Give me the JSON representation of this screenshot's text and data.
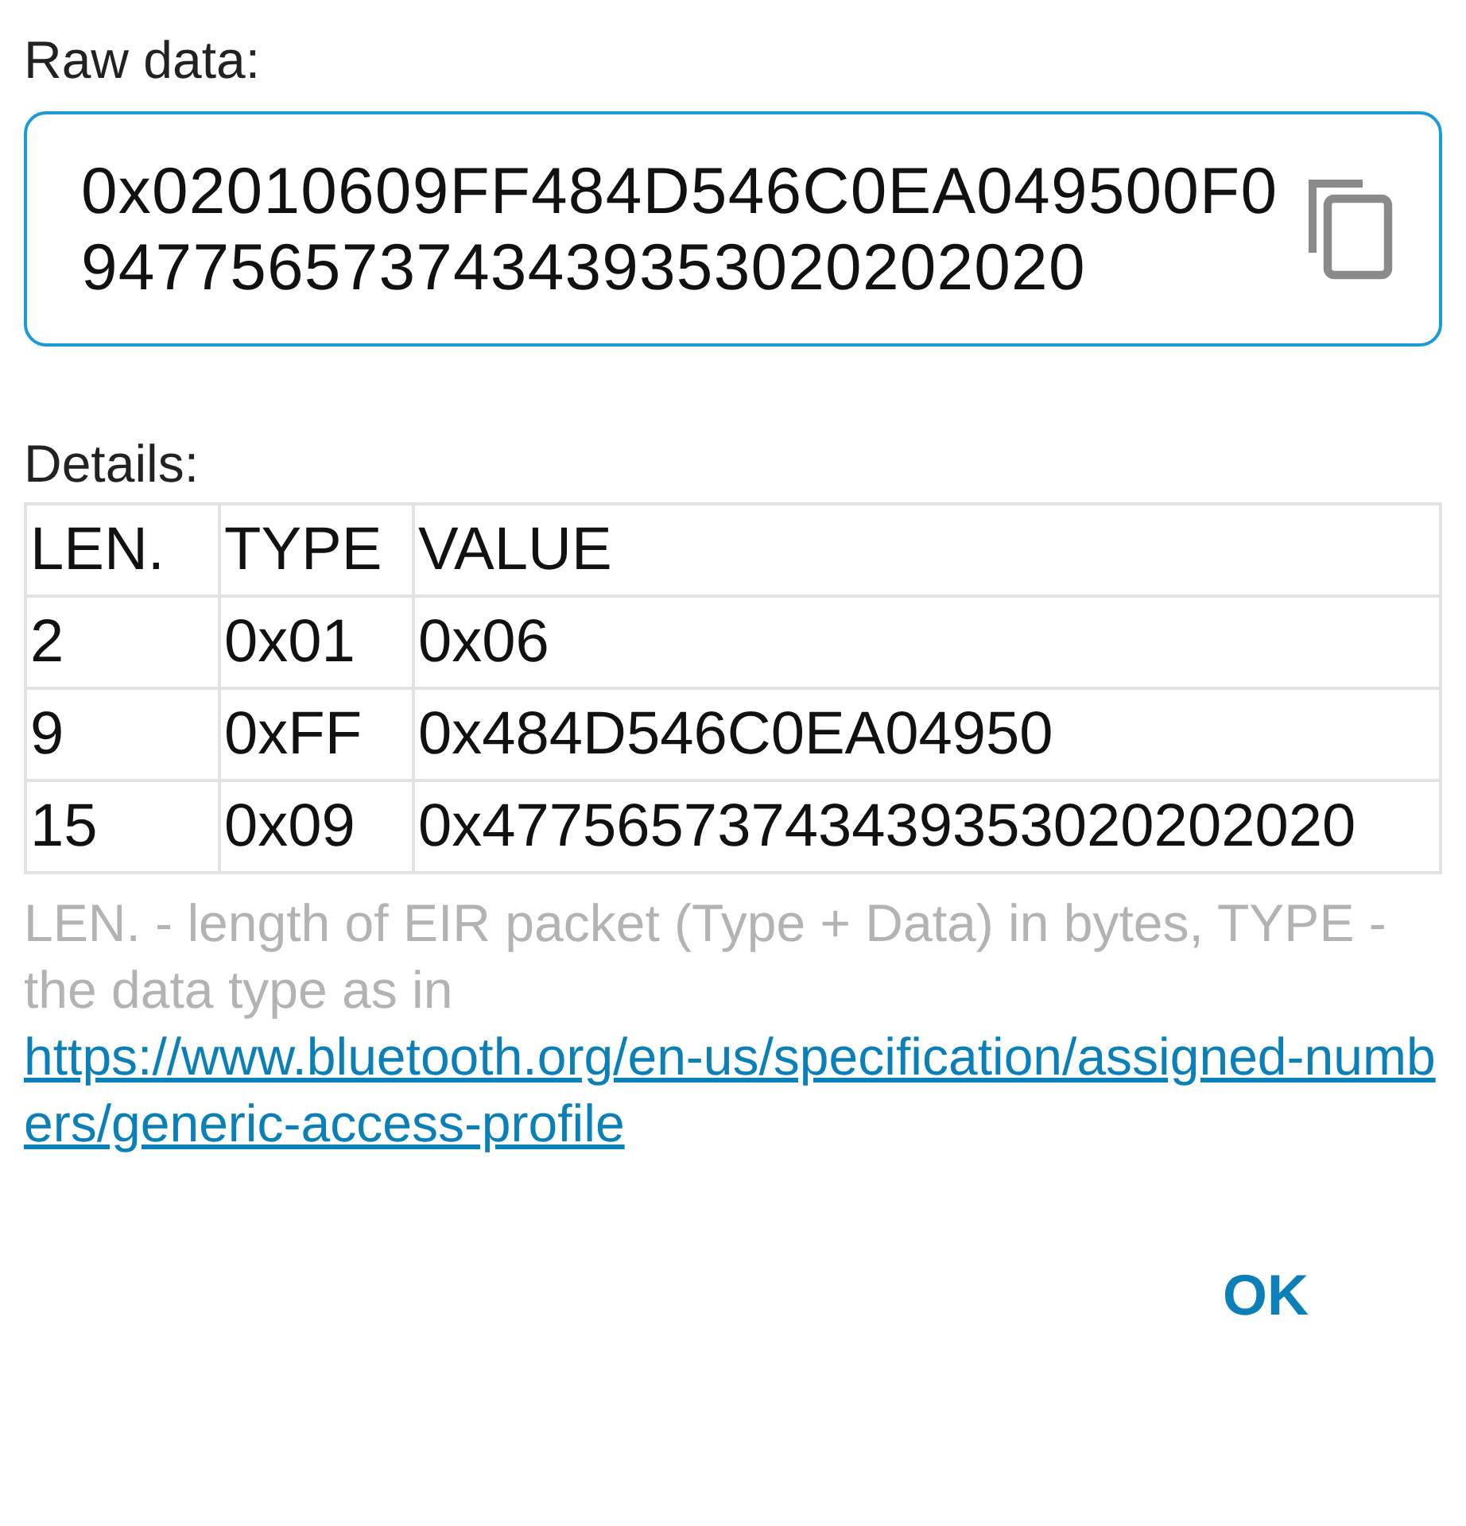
{
  "raw_data": {
    "label": "Raw data:",
    "value": "0x02010609FF484D546C0EA049500F0947756573743439353020202020"
  },
  "details": {
    "label": "Details:",
    "columns": [
      "LEN.",
      "TYPE",
      "VALUE"
    ],
    "rows": [
      {
        "len": "2",
        "type": "0x01",
        "value": "0x06"
      },
      {
        "len": "9",
        "type": "0xFF",
        "value": "0x484D546C0EA04950"
      },
      {
        "len": "15",
        "type": "0x09",
        "value": "0x47756573743439353020202020"
      }
    ]
  },
  "note": {
    "text": "LEN. - length of EIR packet (Type + Data) in bytes, TYPE - the data type as in ",
    "link": "https://www.bluetooth.org/en-us/specification/assigned-numbers/generic-access-profile"
  },
  "buttons": [
    "OK"
  ]
}
